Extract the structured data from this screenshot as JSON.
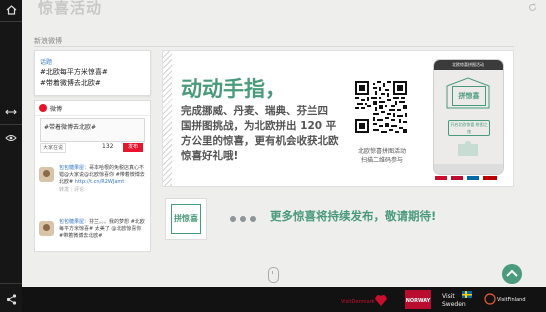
{
  "page": {
    "title": "惊喜活动",
    "section_label": "新浪微博"
  },
  "topic_card": {
    "small": "话题",
    "lines": [
      "#北欧每平方米惊喜#",
      "#带着微博去北欧#"
    ]
  },
  "weibo_widget": {
    "name": "微博",
    "compose_text": "#带着微博去北欧#",
    "share_label": "大家在说",
    "char_count": "132",
    "send_label": "发布",
    "posts": [
      {
        "user": "包包糖果屋：",
        "text": "哥本哈根的免税店真心不错@大家说@北欧惊喜你 #带着微博去北欧#",
        "link": "http://t.cn/R2WJamt",
        "meta": "转发｜评论"
      },
      {
        "user": "包包糖果屋：",
        "text": "芬兰。。。我的梦想 #北欧每平方米惊喜# 太美了 @北欧惊喜你 #带着微博去北欧#",
        "link": "",
        "meta": ""
      }
    ]
  },
  "main_banner": {
    "headline": "动动手指，",
    "lines": [
      "完成挪威、丹麦、瑞典、芬兰四",
      "国拼图挑战，为北欧拼出 120 平",
      "方公里的惊喜，更有机会收获北欧",
      "惊喜好礼哦!"
    ],
    "qr_caption_1": "北欧惊喜拼图活动",
    "qr_caption_2": "扫描二维码参与",
    "phone": {
      "topbar": "北欧惊喜拼图活动",
      "box_label": "拼惊喜",
      "button_label": "开启北欧惊喜 拼图之旅"
    }
  },
  "teaser": {
    "thumb_label": "拼惊喜",
    "text": "更多惊喜将持续发布，敬请期待!"
  },
  "footer": {
    "brands": [
      "Visit Denmark",
      "NORWAY",
      "Visit Sweden",
      "VisitFinland"
    ]
  },
  "colors": {
    "accent": "#4a9a7c",
    "weibo_red": "#e6162d",
    "sidebar": "#161616"
  },
  "icons": [
    "home-icon",
    "share-arrows-icon",
    "eye-icon",
    "share-icon",
    "back-to-top-icon",
    "mouse-scroll-icon",
    "refresh-icon"
  ]
}
